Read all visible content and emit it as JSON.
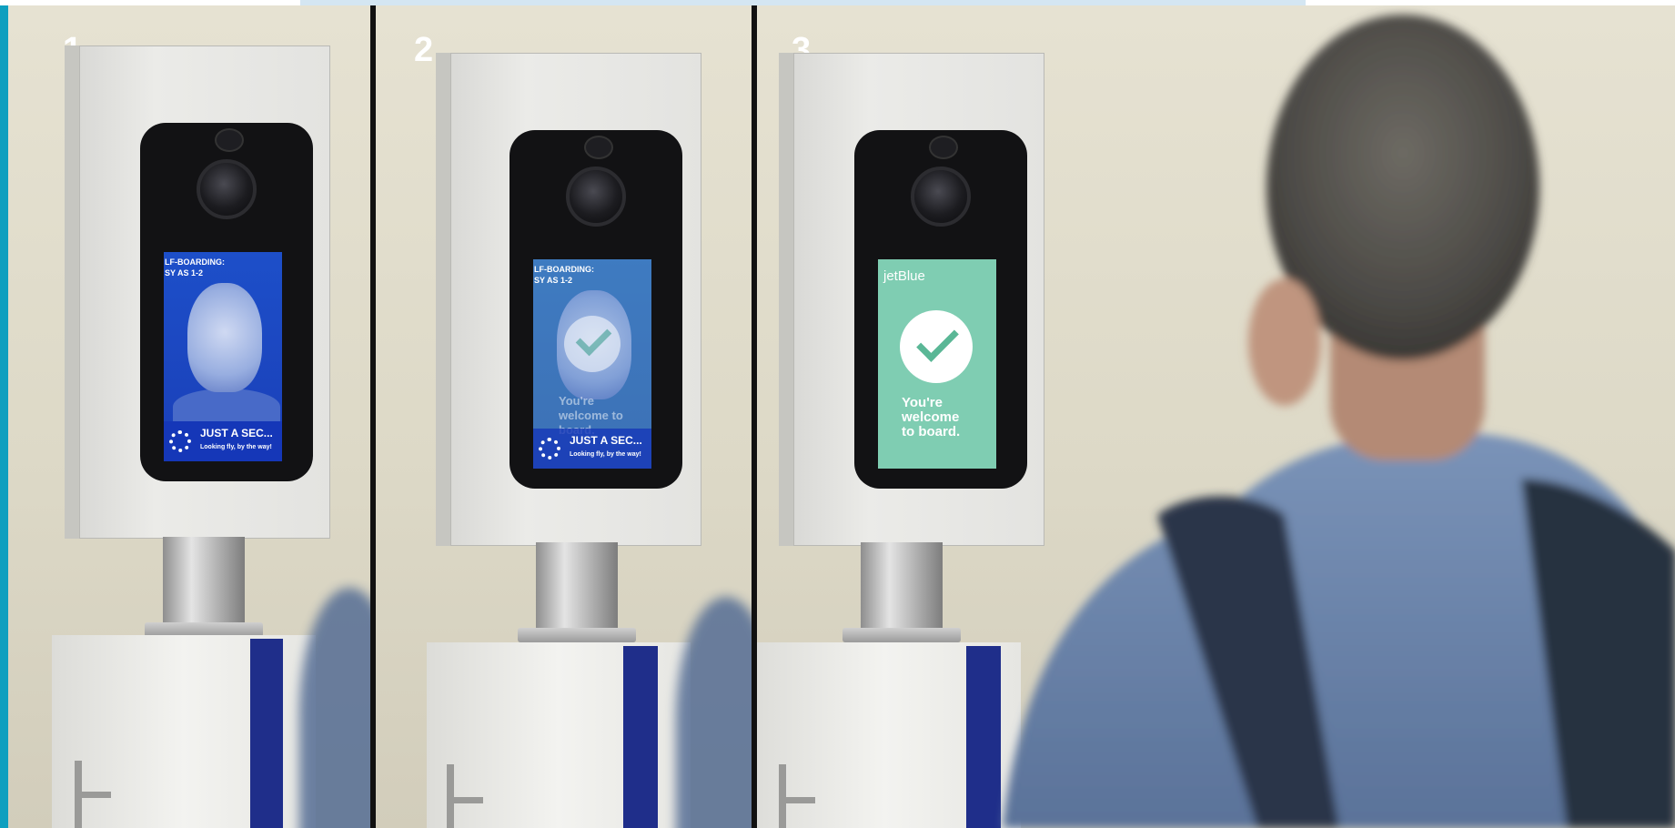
{
  "panels": [
    {
      "label": "1"
    },
    {
      "label": "2"
    },
    {
      "label": "3"
    }
  ],
  "kiosk1": {
    "sidebar_line1": "LF-BOARDING:",
    "sidebar_line2": "SY AS 1-2",
    "status_title": "JUST A SEC...",
    "status_sub": "Looking fly, by the way!"
  },
  "kiosk2": {
    "sidebar_line1": "LF-BOARDING:",
    "sidebar_line2": "SY AS 1-2",
    "status_title": "JUST A SEC...",
    "status_sub": "Looking fly, by the way!",
    "overlay_text": "You're welcome to board."
  },
  "kiosk3": {
    "brand": "jetBlue",
    "message_line1": "You're",
    "message_line2": "welcome",
    "message_line3": "to board."
  },
  "colors": {
    "screen_blue": "#1d4fc9",
    "screen_green": "#7fcdb2",
    "stripe_navy": "#1f2e8a",
    "border_teal": "#0f9fbf"
  }
}
